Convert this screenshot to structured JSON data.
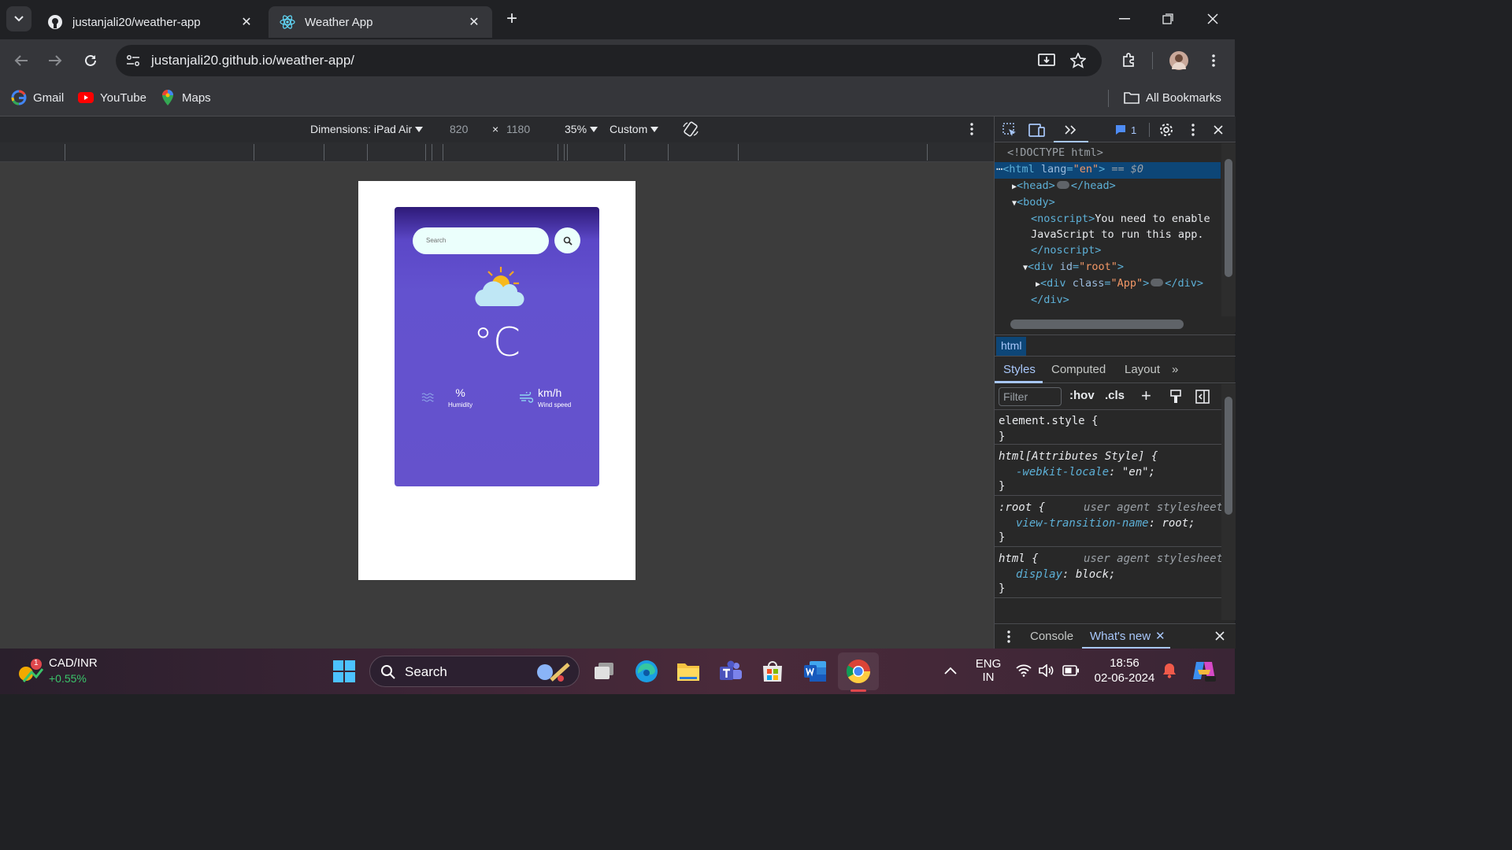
{
  "browser": {
    "tabs": [
      {
        "title": "justanjali20/weather-app",
        "active": false
      },
      {
        "title": "Weather App",
        "active": true
      }
    ],
    "url": "justanjali20.github.io/weather-app/",
    "bookmarks": [
      {
        "label": "Gmail"
      },
      {
        "label": "YouTube"
      },
      {
        "label": "Maps"
      }
    ],
    "all_bookmarks": "All Bookmarks"
  },
  "device_toolbar": {
    "dimensions_label": "Dimensions: iPad Air",
    "width": "820",
    "times": "×",
    "height": "1180",
    "zoom": "35%",
    "throttle": "Custom"
  },
  "weather_app": {
    "search_placeholder": "Search",
    "temperature": "°C",
    "humidity_value": "%",
    "humidity_label": "Humidity",
    "wind_value": "km/h",
    "wind_label": "Wind speed"
  },
  "devtools": {
    "issues_count": "1",
    "dom": {
      "doctype": "<!DOCTYPE html>",
      "html_open_tag": "<html",
      "html_attr": "lang",
      "html_attr_val": "\"en\"",
      "html_close": ">",
      "html_suffix": "== $0",
      "head": "<head>",
      "head_close": "</head>",
      "body": "<body>",
      "noscript_open": "<noscript>",
      "noscript_text_1": "You need to enable",
      "noscript_text_2": "JavaScript to run this app.",
      "noscript_close": "</noscript>",
      "root_open": "<div",
      "root_attr": "id",
      "root_val": "\"root\"",
      "app_open": "<div",
      "app_attr": "class",
      "app_val": "\"App\"",
      "div_close": "</div>"
    },
    "breadcrumb": "html",
    "subtabs": [
      "Styles",
      "Computed",
      "Layout"
    ],
    "filter_placeholder": "Filter",
    "filter_buttons": [
      ":hov",
      ".cls"
    ],
    "styles": {
      "r1_selector": "element.style {",
      "brace_close": "}",
      "r2_selector": "html[Attributes Style] {",
      "r2_prop": "-webkit-locale",
      "r2_val": "\"en\";",
      "r3_selector": ":root {",
      "ua_label": "user agent stylesheet",
      "r3_prop": "view-transition-name",
      "r3_val": "root;",
      "r4_selector": "html {",
      "r4_prop": "display",
      "r4_val": "block;"
    },
    "drawer_tabs": [
      "Console",
      "What's new"
    ]
  },
  "taskbar": {
    "ticker_name": "CAD/INR",
    "ticker_change": "+0.55%",
    "ticker_badge": "1",
    "search_label": "Search",
    "lang_1": "ENG",
    "lang_2": "IN",
    "time": "18:56",
    "date": "02-06-2024"
  },
  "colors": {
    "card_purple": "#6552cc",
    "devtools_selection": "#0d4677",
    "chrome_dark": "#202124"
  }
}
